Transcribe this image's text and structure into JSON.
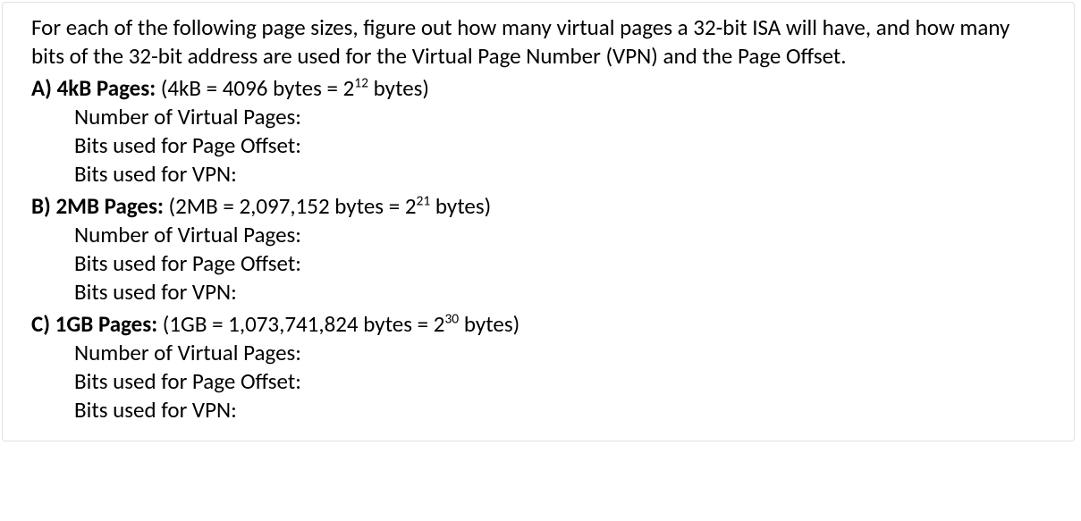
{
  "intro": "For each of the following page sizes, figure out how many virtual pages a 32-bit ISA will have, and how many bits of the 32-bit address are used for the Virtual Page Number (VPN) and the Page Offset.",
  "sections": {
    "a": {
      "label": "A) 4kB Pages:",
      "detail_pre": " (4kB = 4096 bytes = 2",
      "detail_exp": "12",
      "detail_post": " bytes)",
      "line1": "Number of Virtual Pages:",
      "line2": "Bits used for Page Offset:",
      "line3": "Bits used for VPN:"
    },
    "b": {
      "label": "B) 2MB Pages:",
      "detail_pre": " (2MB = 2,097,152 bytes = 2",
      "detail_exp": "21",
      "detail_post": " bytes)",
      "line1": "Number of Virtual Pages:",
      "line2": "Bits used for Page Offset:",
      "line3": "Bits used for VPN:"
    },
    "c": {
      "label": "C) 1GB Pages:",
      "detail_pre": " (1GB = 1,073,741,824 bytes = 2",
      "detail_exp": "30",
      "detail_post": " bytes)",
      "line1": "Number of Virtual Pages:",
      "line2": "Bits used for Page Offset:",
      "line3": "Bits used for VPN:"
    }
  }
}
